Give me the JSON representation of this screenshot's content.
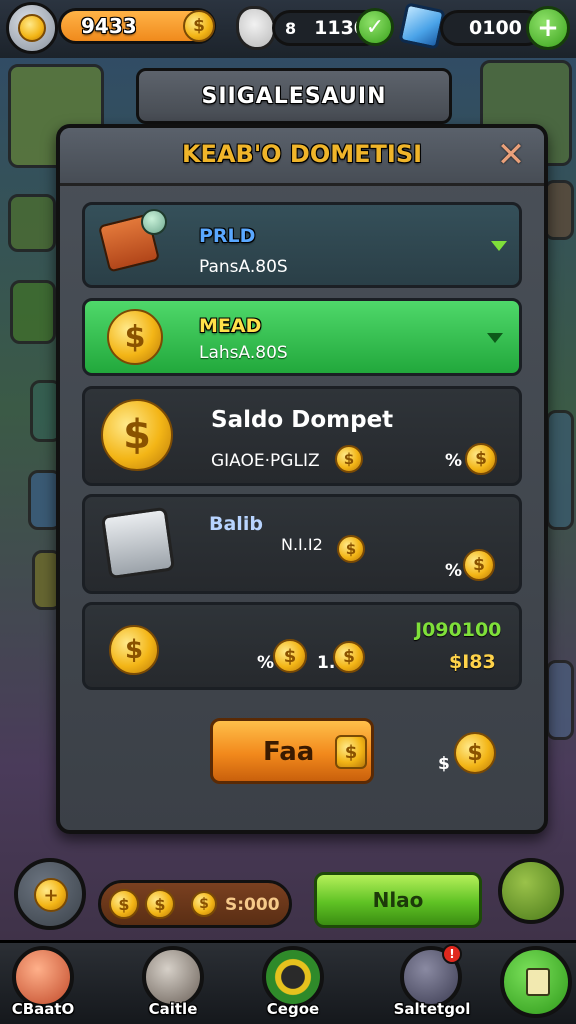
{
  "header": {
    "gold_amount": "9433",
    "gems_amount": "1130",
    "gems_prefix": "8",
    "crystals_amount": "0100"
  },
  "banner": {
    "title": "SIIGALESAUIN"
  },
  "dialog": {
    "title": "KEAB'O DOMETISI",
    "close_icon": "close-x-icon",
    "options": [
      {
        "title": "PRLD",
        "subtitle": "PansA.80S",
        "selected": false
      },
      {
        "title": "MEAD",
        "subtitle": "LahsA.80S",
        "selected": true
      }
    ],
    "wallet": {
      "title": "Saldo Dompet",
      "label": "GIAOE·PGLIZ",
      "multiplier": "%"
    },
    "cash_row": {
      "title": "Balib",
      "label": "N.I.I2",
      "multiplier": "%"
    },
    "coin_row": {
      "prefix": "%",
      "count": "1.",
      "amount_top": "J090100",
      "amount_bottom": "$I83"
    },
    "action_button": {
      "label": "Faa"
    },
    "action_multiplier": "$"
  },
  "bottom_actions": {
    "coin_bar_value": "S:000",
    "green_button_label": "Nlao"
  },
  "nav": [
    {
      "label": "CBaatO",
      "icon": "avatar-icon"
    },
    {
      "label": "Caitle",
      "icon": "mascot-icon"
    },
    {
      "label": "Cegoe",
      "icon": "ring-icon"
    },
    {
      "label": "Saltetgol",
      "icon": "badge-icon",
      "notification": "!"
    },
    {
      "label": "",
      "icon": "document-icon"
    }
  ],
  "colors": {
    "accent_green": "#5fc224",
    "accent_orange": "#f2891c",
    "gold": "#f3b516",
    "title_gold": "#f0b52a"
  }
}
